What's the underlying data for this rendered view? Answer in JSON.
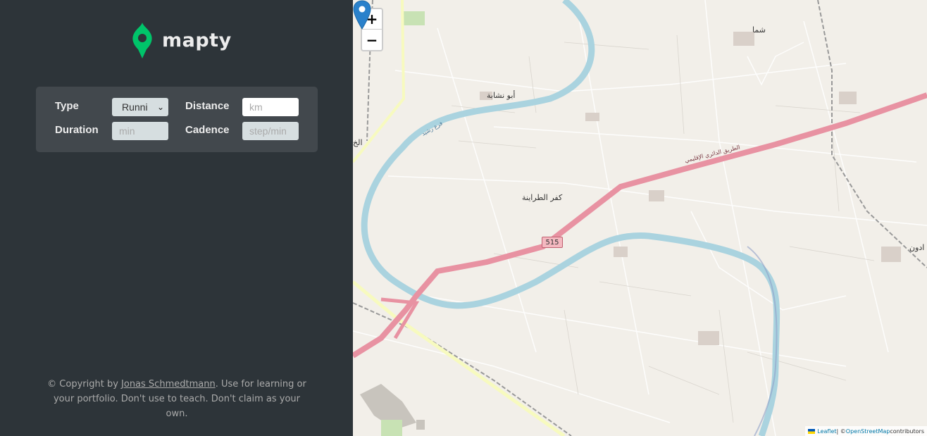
{
  "brand": {
    "name": "mapty",
    "logo_icon": "map-pin-icon",
    "accent": "#00c46a"
  },
  "form": {
    "type_label": "Type",
    "type_value": "Runni",
    "distance_label": "Distance",
    "distance_placeholder": "km",
    "duration_label": "Duration",
    "duration_placeholder": "min",
    "cadence_label": "Cadence",
    "cadence_placeholder": "step/min"
  },
  "footer": {
    "prefix": "© Copyright by ",
    "author": "Jonas Schmedtmann",
    "suffix": ". Use for learning or your portfolio. Don't use to teach. Don't claim as your own."
  },
  "map": {
    "zoom_in": "+",
    "zoom_out": "−",
    "marker_icon": "map-marker-icon",
    "marker_color": "#2a81cb",
    "road_number": "515",
    "labels": {
      "village1": "أبو نشابة",
      "village2": "شما",
      "village3": "كفر الطراينة",
      "road_name": "الطريق الدائري الإقليمي",
      "canal": "فرع رشيد",
      "edge1": "الخ",
      "edge2": "ادون"
    },
    "attribution": {
      "leaflet": "Leaflet",
      "sep": " | © ",
      "osm": "OpenStreetMap",
      "contributors": " contributors"
    }
  }
}
